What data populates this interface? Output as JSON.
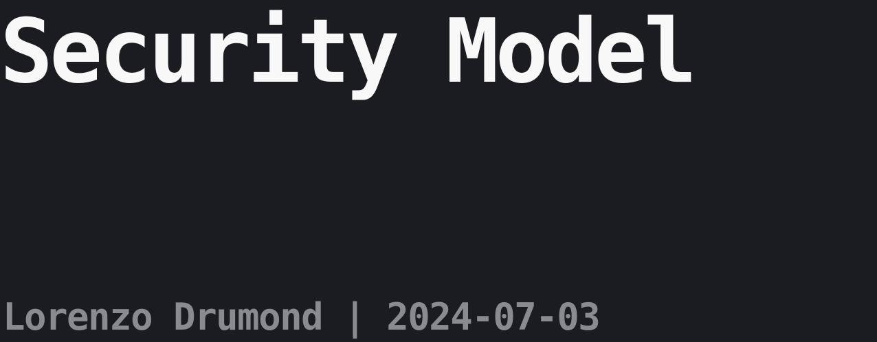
{
  "slide": {
    "title": "Security Model",
    "byline": "Lorenzo Drumond | 2024-07-03"
  },
  "colors": {
    "background": "#1b1c21",
    "title": "#f8f8f8",
    "byline": "#8a8b90"
  }
}
